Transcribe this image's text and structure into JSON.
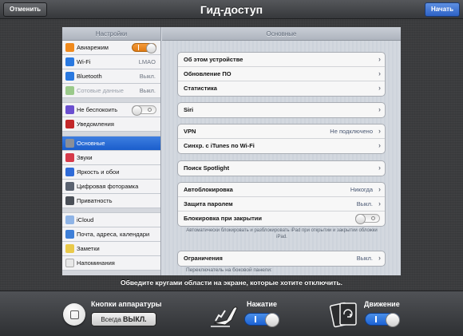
{
  "topbar": {
    "title": "Гид-доступ",
    "cancel_label": "Отменить",
    "start_label": "Начать"
  },
  "sidebar": {
    "header": "Настройки",
    "items": [
      {
        "label": "Авиарежим",
        "icon": "airplane-icon",
        "color": "#f08a1d"
      },
      {
        "label": "Wi-Fi",
        "value": "LMAO",
        "icon": "wifi-icon",
        "color": "#2a79e0"
      },
      {
        "label": "Bluetooth",
        "value": "Выкл.",
        "icon": "bluetooth-icon",
        "color": "#2a79e0"
      },
      {
        "label": "Сотовые данные",
        "value": "Выкл.",
        "icon": "cellular-icon",
        "color": "#5bb532"
      },
      {
        "label": "Не беспокоить",
        "icon": "moon-icon",
        "color": "#6b4fd0"
      },
      {
        "label": "Уведомления",
        "icon": "notifications-icon",
        "color": "#c3282a"
      },
      {
        "label": "Основные",
        "icon": "gear-icon",
        "color": "#8a8f98"
      },
      {
        "label": "Звуки",
        "icon": "speaker-icon",
        "color": "#d63a4a"
      },
      {
        "label": "Яркость и обои",
        "icon": "brightness-icon",
        "color": "#2f6bd8"
      },
      {
        "label": "Цифровая фоторамка",
        "icon": "photo-frame-icon",
        "color": "#5a6270"
      },
      {
        "label": "Приватность",
        "icon": "hand-icon",
        "color": "#4a4f57"
      },
      {
        "label": "iCloud",
        "icon": "cloud-icon",
        "color": "#6fa0e0"
      },
      {
        "label": "Почта, адреса, календари",
        "icon": "mail-icon",
        "color": "#3e7fd8"
      },
      {
        "label": "Заметки",
        "icon": "notes-icon",
        "color": "#e9c94a"
      },
      {
        "label": "Напоминания",
        "icon": "reminders-icon",
        "color": "#e8e8e8"
      }
    ]
  },
  "main": {
    "header": "Основные",
    "group1": [
      "Об этом устройстве",
      "Обновление ПО",
      "Статистика"
    ],
    "siri": "Siri",
    "vpn": {
      "label": "VPN",
      "value": "Не подключено"
    },
    "itunes_sync": "Синхр. с iTunes по Wi-Fi",
    "spotlight": "Поиск Spotlight",
    "autolock": {
      "label": "Автоблокировка",
      "value": "Никогда"
    },
    "passcode": {
      "label": "Защита паролем",
      "value": "Выкл."
    },
    "lock_on_close": "Блокировка при закрытии",
    "lock_note": "Автоматически блокировать и разблокировать iPad при открытии и закрытии обложки iPad.",
    "restrictions": {
      "label": "Ограничения",
      "value": "Выкл."
    },
    "cut_text": "Переключатель на боковой панели:"
  },
  "instruction": "Обведите кругами области на экране, которые хотите отключить.",
  "bottom": {
    "hardware_title": "Кнопки аппаратуры",
    "hardware_button_prefix": "Всегда",
    "hardware_button_state": "ВЫКЛ.",
    "touch_title": "Нажатие",
    "motion_title": "Движение"
  }
}
